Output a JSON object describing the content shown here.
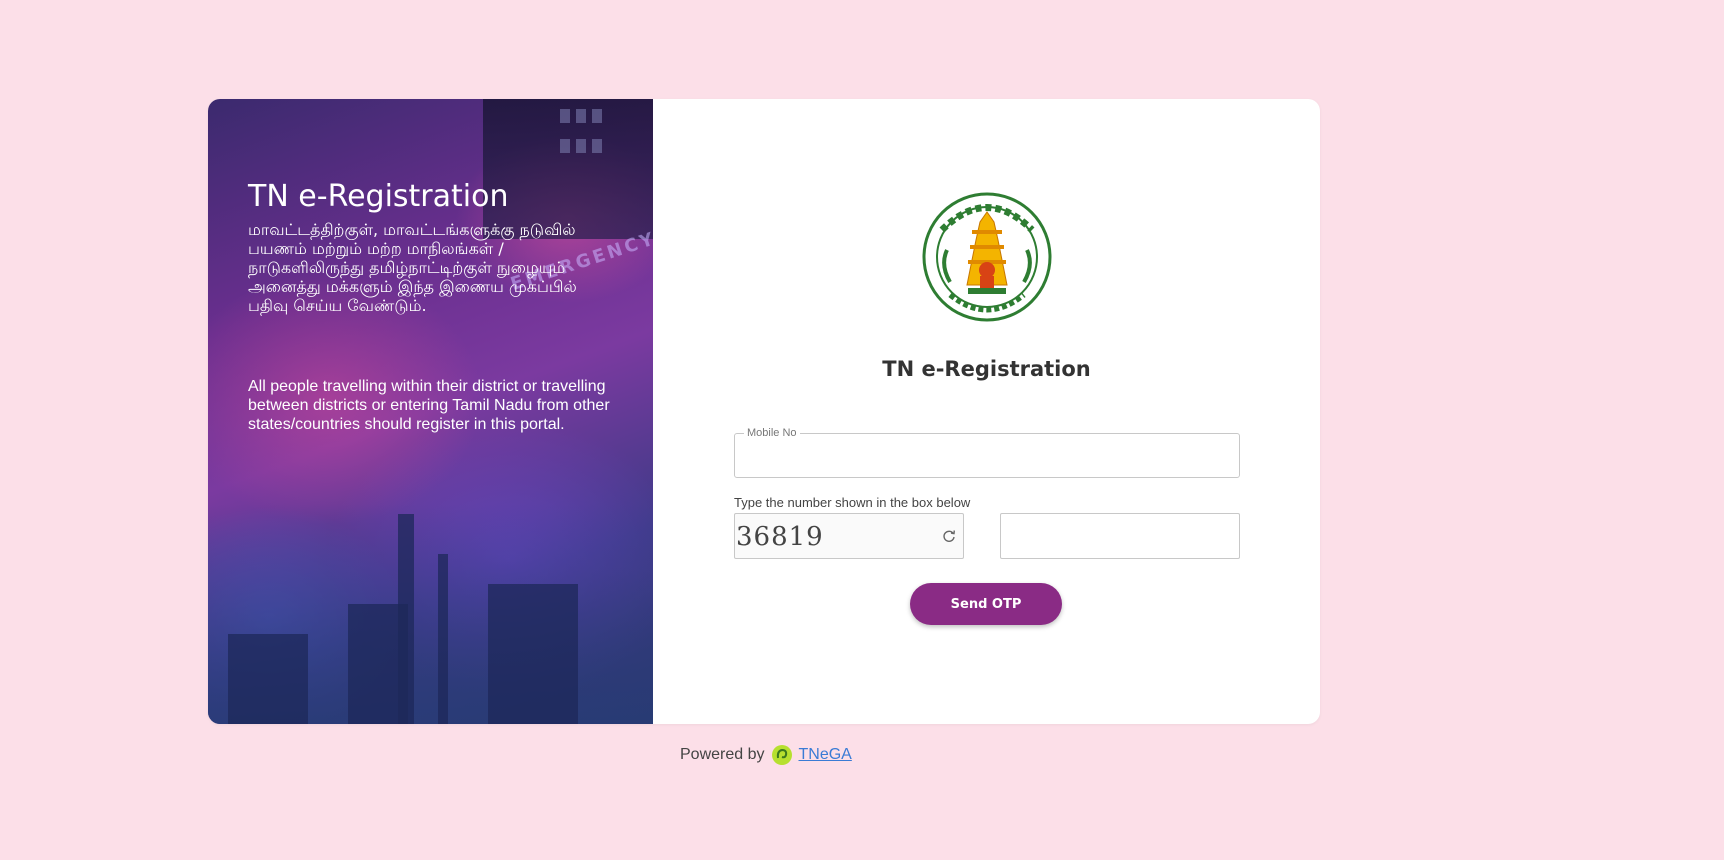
{
  "left": {
    "title": "TN e-Registration",
    "tamil_text": "மாவட்டத்திற்குள், மாவட்டங்களுக்கு நடுவில் பயணம் மற்றும் மற்ற மாநிலங்கள் / நாடுகளிலிருந்து தமிழ்நாட்டிற்குள் நுழையும் அனைத்து மக்களும் இந்த இணைய முகப்பில் பதிவு செய்ய வேண்டும்.",
    "english_text": "All people travelling within their district or travelling between districts or entering Tamil Nadu from other states/countries should register in this portal.",
    "background_sign": "EMERGENCY"
  },
  "right": {
    "logo_icon": "tamil-nadu-emblem-icon",
    "title": "TN e-Registration",
    "mobile_field": {
      "label": "Mobile No",
      "value": "",
      "placeholder": ""
    },
    "captcha": {
      "caption": "Type the number shown in the box below",
      "code": "36819",
      "refresh_icon": "refresh-icon",
      "input_value": ""
    },
    "send_button_label": "Send OTP"
  },
  "footer": {
    "powered_by": "Powered by",
    "link_text": "TNeGA",
    "logo_icon": "tnega-logo-icon"
  },
  "colors": {
    "page_background": "#fcdfe8",
    "button": "#8a2b85",
    "link": "#3a7bd5",
    "emblem_green": "#2e7d32",
    "emblem_gold": "#f4b400"
  }
}
